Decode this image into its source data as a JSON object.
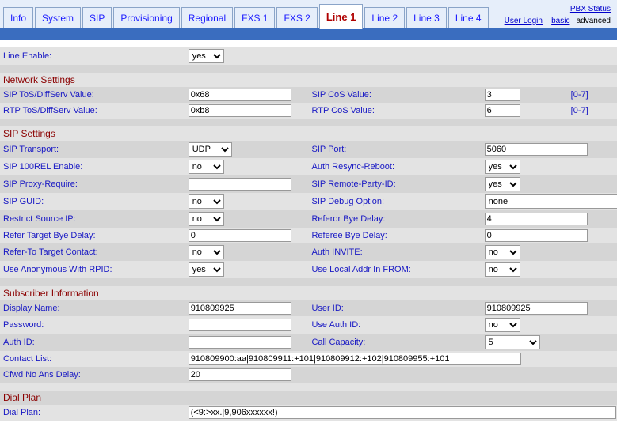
{
  "top": {
    "tabs": [
      "Info",
      "System",
      "SIP",
      "Provisioning",
      "Regional",
      "FXS 1",
      "FXS 2",
      "Line 1",
      "Line 2",
      "Line 3",
      "Line 4"
    ],
    "active_index": 7,
    "links": {
      "pbx_status": "PBX Status",
      "user_login": "User Login",
      "basic": "basic",
      "advanced": "advanced",
      "sep": " | "
    }
  },
  "line_enable": {
    "label": "Line Enable:",
    "value": "yes"
  },
  "network": {
    "title": "Network Settings",
    "sip_tos": {
      "label": "SIP ToS/DiffServ Value:",
      "value": "0x68"
    },
    "sip_cos": {
      "label": "SIP CoS Value:",
      "value": "3",
      "hint": "[0-7]"
    },
    "rtp_tos": {
      "label": "RTP ToS/DiffServ Value:",
      "value": "0xb8"
    },
    "rtp_cos": {
      "label": "RTP CoS Value:",
      "value": "6",
      "hint": "[0-7]"
    }
  },
  "sip": {
    "title": "SIP Settings",
    "transport": {
      "label": "SIP Transport:",
      "value": "UDP"
    },
    "port": {
      "label": "SIP Port:",
      "value": "5060"
    },
    "rel100": {
      "label": "SIP 100REL Enable:",
      "value": "no"
    },
    "auth_resync": {
      "label": "Auth Resync-Reboot:",
      "value": "yes"
    },
    "proxy_require": {
      "label": "SIP Proxy-Require:",
      "value": ""
    },
    "remote_party": {
      "label": "SIP Remote-Party-ID:",
      "value": "yes"
    },
    "guid": {
      "label": "SIP GUID:",
      "value": "no"
    },
    "debug": {
      "label": "SIP Debug Option:",
      "value": "none"
    },
    "restrict_ip": {
      "label": "Restrict Source IP:",
      "value": "no"
    },
    "referor_bye": {
      "label": "Referor Bye Delay:",
      "value": "4"
    },
    "ref_tgt_bye": {
      "label": "Refer Target Bye Delay:",
      "value": "0"
    },
    "referee_bye": {
      "label": "Referee Bye Delay:",
      "value": "0"
    },
    "ref_to_tgt_c": {
      "label": "Refer-To Target Contact:",
      "value": "no"
    },
    "auth_invite": {
      "label": "Auth INVITE:",
      "value": "no"
    },
    "anon_rpid": {
      "label": "Use Anonymous With RPID:",
      "value": "yes"
    },
    "local_from": {
      "label": "Use Local Addr In FROM:",
      "value": "no"
    }
  },
  "subscriber": {
    "title": "Subscriber Information",
    "display_name": {
      "label": "Display Name:",
      "value": "910809925"
    },
    "user_id": {
      "label": "User ID:",
      "value": "910809925"
    },
    "password": {
      "label": "Password:",
      "value": ""
    },
    "use_auth_id": {
      "label": "Use Auth ID:",
      "value": "no"
    },
    "auth_id": {
      "label": "Auth ID:",
      "value": ""
    },
    "call_capacity": {
      "label": "Call Capacity:",
      "value": "5"
    },
    "contact_list": {
      "label": "Contact List:",
      "value": "910809900:aa|910809911:+101|910809912:+102|910809955:+101"
    },
    "cfwd_noans": {
      "label": "Cfwd No Ans Delay:",
      "value": "20"
    }
  },
  "dialplan": {
    "title": "Dial Plan",
    "dial_plan": {
      "label": "Dial Plan:",
      "value": "(<9:>xx.|9,906xxxxxx!)"
    }
  }
}
